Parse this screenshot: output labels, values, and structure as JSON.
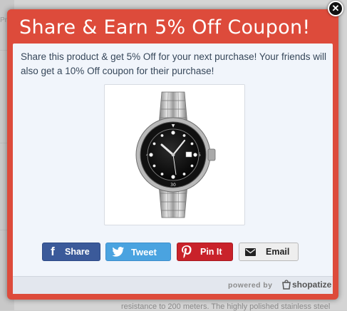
{
  "background": {
    "fragment_left": "Pr",
    "fragment_bottom": "resistance to 200 meters. The highly polished stainless steel"
  },
  "modal": {
    "title": "Share & Earn 5% Off Coupon!",
    "description": "Share this product & get 5% Off for your next purchase! Your friends will also get a 10% Off coupon for their purchase!",
    "product_image_icon": "wristwatch-image",
    "buttons": {
      "facebook": "Share",
      "twitter": "Tweet",
      "pinterest": "Pin It",
      "email": "Email"
    },
    "footer": {
      "powered_by": "powered by",
      "brand": "shopatize"
    }
  },
  "colors": {
    "modal_header": "#dd4b3b",
    "facebook": "#3b5a9a",
    "twitter": "#4aa3e0",
    "pinterest": "#c9222a"
  },
  "close_icon": "close-icon"
}
